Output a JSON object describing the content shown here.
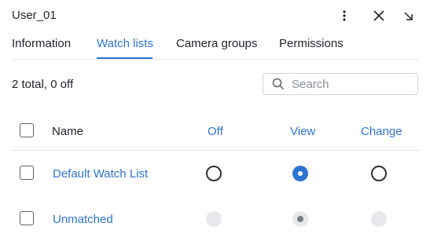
{
  "header": {
    "title": "User_01",
    "more_icon": "more-vertical-icon",
    "close_icon": "close-icon",
    "collapse_icon": "arrow-down-right-icon"
  },
  "tabs": [
    {
      "label": "Information",
      "active": false
    },
    {
      "label": "Watch lists",
      "active": true
    },
    {
      "label": "Camera groups",
      "active": false
    },
    {
      "label": "Permissions",
      "active": false
    }
  ],
  "summary": "2 total, 0 off",
  "search": {
    "placeholder": "Search",
    "value": "",
    "icon": "search-icon"
  },
  "table": {
    "columns": {
      "name": "Name",
      "off": "Off",
      "view": "View",
      "change": "Change"
    },
    "rows": [
      {
        "label": "Default Watch List",
        "checked": false,
        "permission": "View",
        "enabled": true
      },
      {
        "label": "Unmatched",
        "checked": false,
        "permission": "View",
        "enabled": false
      }
    ]
  },
  "colors": {
    "accent": "#2f74d0",
    "disabled_radio": "#e6e8eb"
  }
}
